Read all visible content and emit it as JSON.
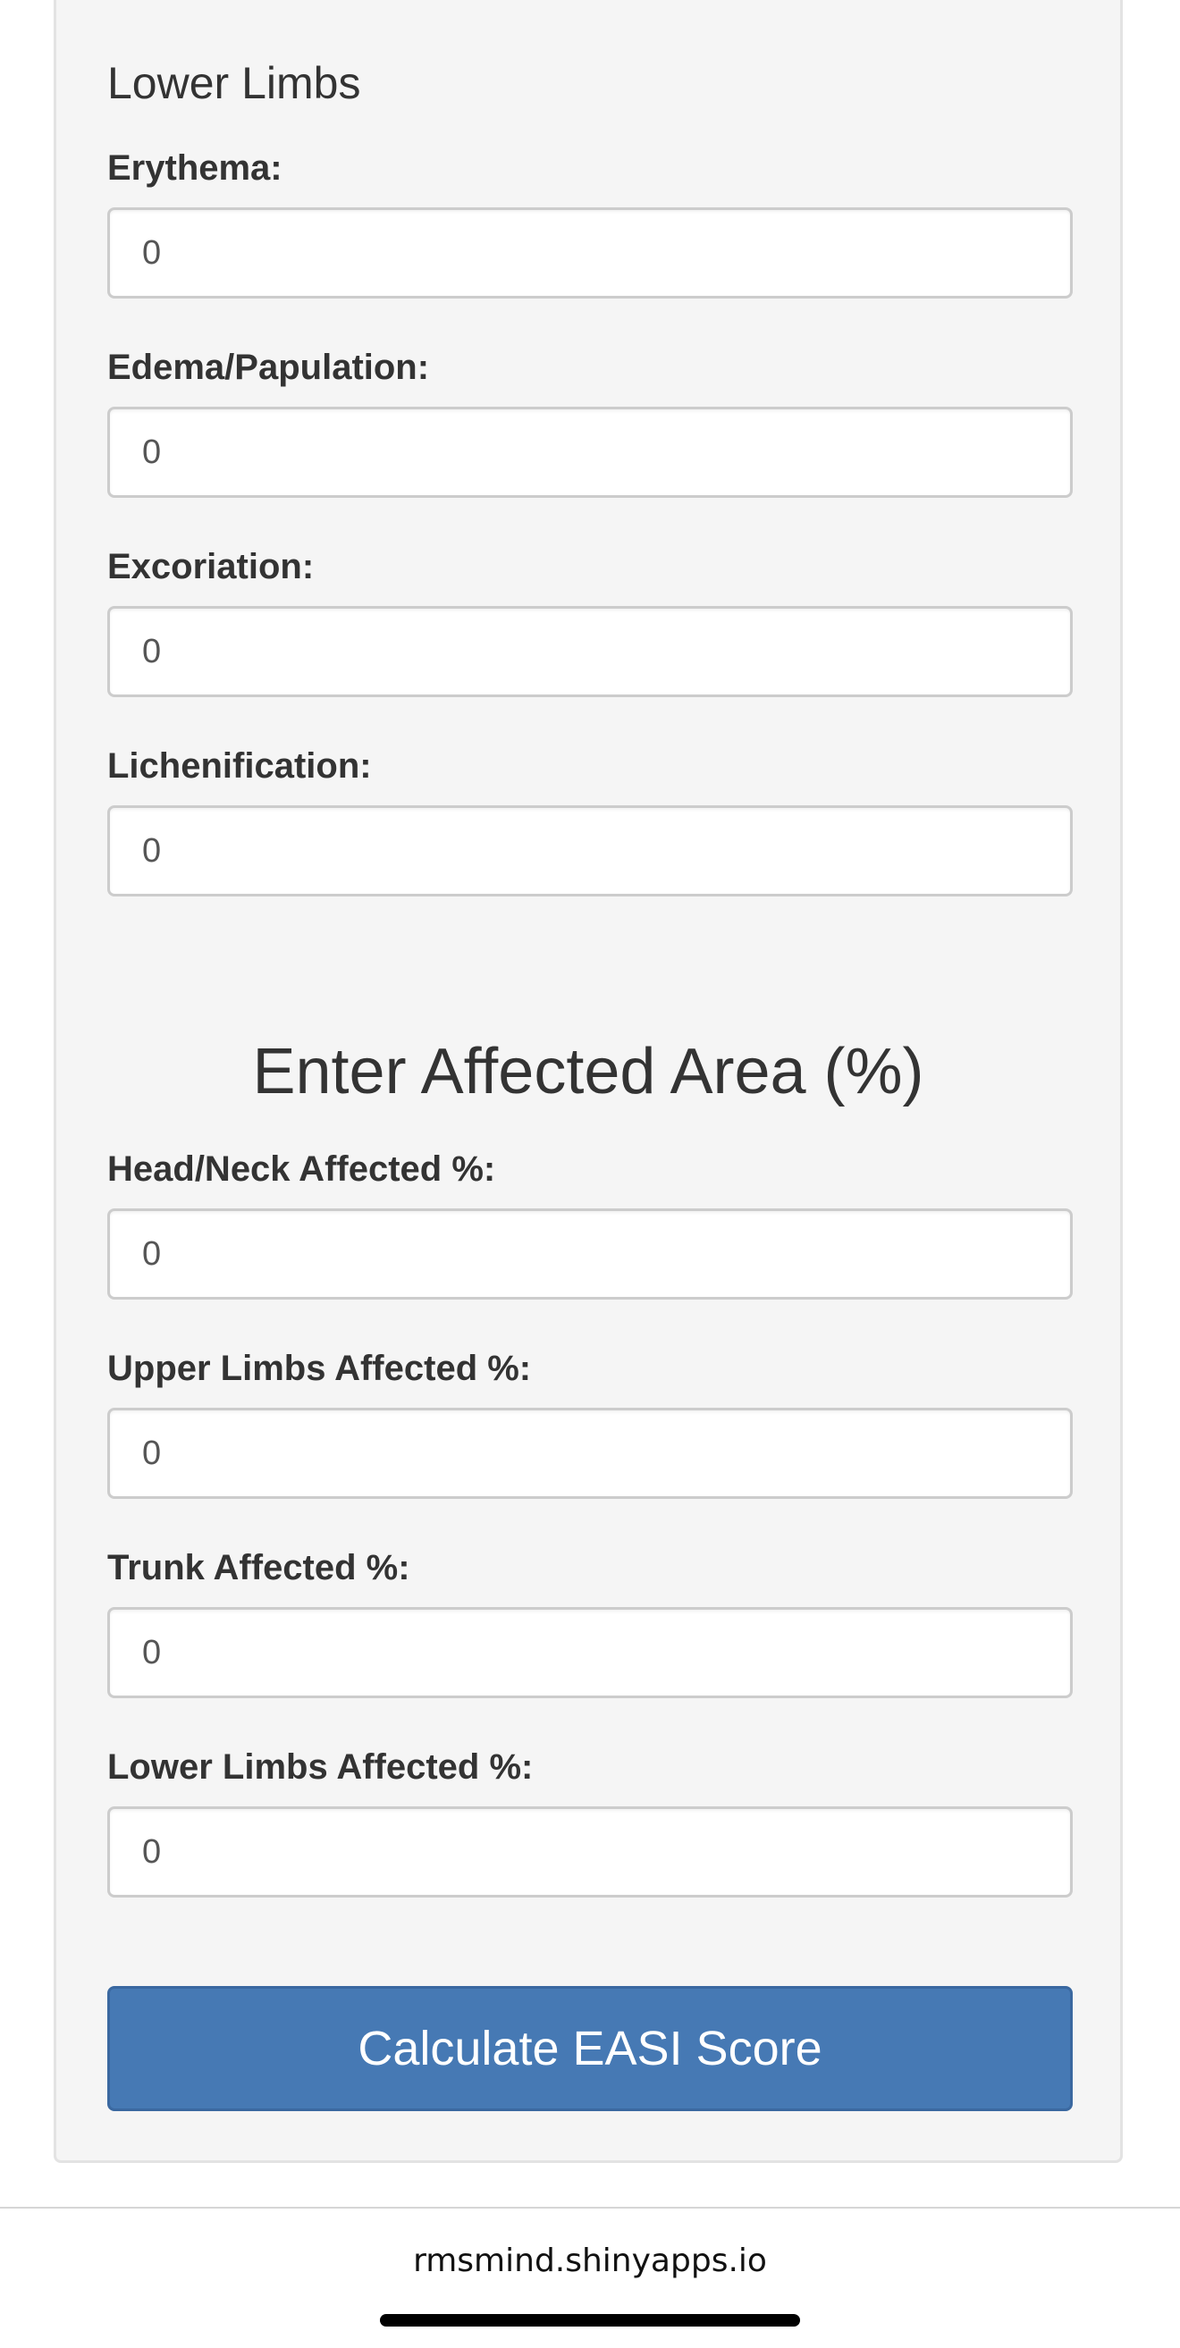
{
  "lower_limbs_section": {
    "title": "Lower Limbs",
    "fields": [
      {
        "label": "Erythema:",
        "value": "0"
      },
      {
        "label": "Edema/Papulation:",
        "value": "0"
      },
      {
        "label": "Excoriation:",
        "value": "0"
      },
      {
        "label": "Lichenification:",
        "value": "0"
      }
    ]
  },
  "affected_area_section": {
    "title": "Enter Affected Area (%)",
    "fields": [
      {
        "label": "Head/Neck Affected %:",
        "value": "0"
      },
      {
        "label": "Upper Limbs Affected %:",
        "value": "0"
      },
      {
        "label": "Trunk Affected %:",
        "value": "0"
      },
      {
        "label": "Lower Limbs Affected %:",
        "value": "0"
      }
    ]
  },
  "calculate_button": {
    "label": "Calculate EASI Score"
  },
  "browser": {
    "url": "rmsmind.shinyapps.io"
  },
  "colors": {
    "panel_bg": "#f5f5f5",
    "button_bg": "#4679b4",
    "text": "#333333"
  }
}
